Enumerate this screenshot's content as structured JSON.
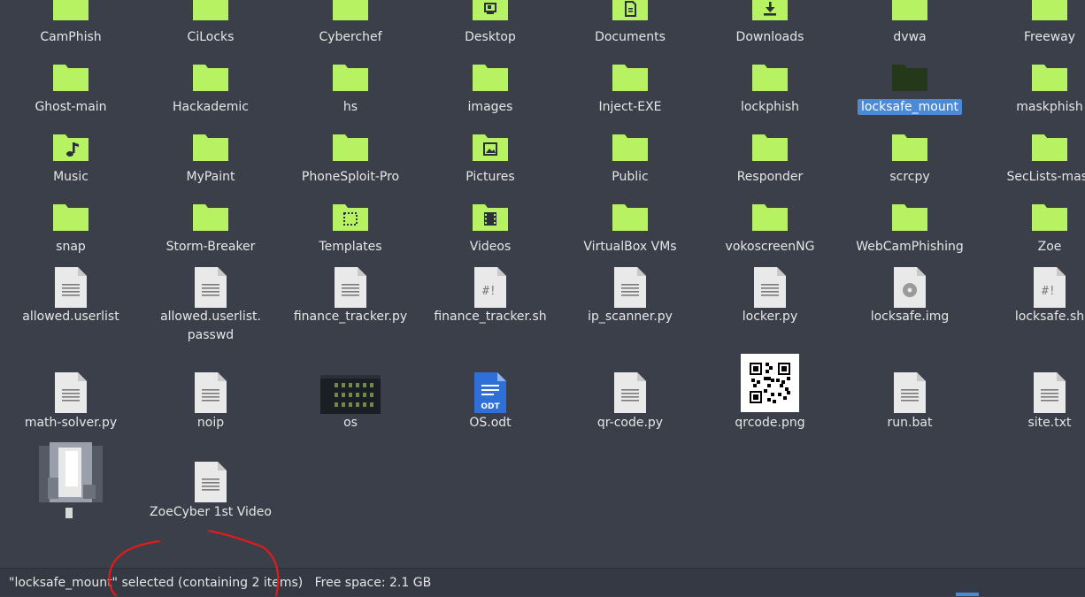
{
  "colors": {
    "background": "#3b3f4a",
    "folder": "#b6f261",
    "folder_dark": "#24381a",
    "selection": "#4c8ad6",
    "annotation": "#e01b1b"
  },
  "files": [
    {
      "label": "CamPhish",
      "icon": "folder"
    },
    {
      "label": "CiLocks",
      "icon": "folder"
    },
    {
      "label": "Cyberchef",
      "icon": "folder"
    },
    {
      "label": "Desktop",
      "icon": "folder-desktop"
    },
    {
      "label": "Documents",
      "icon": "folder-documents"
    },
    {
      "label": "Downloads",
      "icon": "folder-downloads"
    },
    {
      "label": "dvwa",
      "icon": "folder"
    },
    {
      "label": "Freeway",
      "icon": "folder"
    },
    {
      "label": "Ghost-main",
      "icon": "folder"
    },
    {
      "label": "Hackademic",
      "icon": "folder"
    },
    {
      "label": "hs",
      "icon": "folder"
    },
    {
      "label": "images",
      "icon": "folder"
    },
    {
      "label": "Inject-EXE",
      "icon": "folder"
    },
    {
      "label": "lockphish",
      "icon": "folder"
    },
    {
      "label": "locksafe_mount",
      "icon": "folder-dark",
      "selected": true
    },
    {
      "label": "maskphish",
      "icon": "folder"
    },
    {
      "label": "Music",
      "icon": "folder-music"
    },
    {
      "label": "MyPaint",
      "icon": "folder"
    },
    {
      "label": "PhoneSploit-Pro",
      "icon": "folder"
    },
    {
      "label": "Pictures",
      "icon": "folder-pictures"
    },
    {
      "label": "Public",
      "icon": "folder"
    },
    {
      "label": "Responder",
      "icon": "folder"
    },
    {
      "label": "scrcpy",
      "icon": "folder"
    },
    {
      "label": "SecLists-mast",
      "icon": "folder"
    },
    {
      "label": "snap",
      "icon": "folder"
    },
    {
      "label": "Storm-Breaker",
      "icon": "folder"
    },
    {
      "label": "Templates",
      "icon": "folder-templates"
    },
    {
      "label": "Videos",
      "icon": "folder-videos"
    },
    {
      "label": "VirtualBox VMs",
      "icon": "folder"
    },
    {
      "label": "vokoscreenNG",
      "icon": "folder"
    },
    {
      "label": "WebCamPhishing",
      "icon": "folder"
    },
    {
      "label": "Zoe",
      "icon": "folder"
    },
    {
      "label": "allowed.userlist",
      "icon": "text-file"
    },
    {
      "label": "allowed.userlist.\npasswd",
      "icon": "text-file"
    },
    {
      "label": "finance_tracker.py",
      "icon": "text-file"
    },
    {
      "label": "finance_tracker.sh",
      "icon": "script-file"
    },
    {
      "label": "ip_scanner.py",
      "icon": "text-file"
    },
    {
      "label": "locker.py",
      "icon": "text-file"
    },
    {
      "label": "locksafe.img",
      "icon": "disk-image"
    },
    {
      "label": "locksafe.sh",
      "icon": "script-file"
    },
    {
      "label": "math-solver.py",
      "icon": "text-file"
    },
    {
      "label": "noip",
      "icon": "text-file"
    },
    {
      "label": "os",
      "icon": "screenshot-thumbnail"
    },
    {
      "label": "OS.odt",
      "icon": "odt-document"
    },
    {
      "label": "qr-code.py",
      "icon": "text-file"
    },
    {
      "label": "qrcode.png",
      "icon": "qr-thumbnail"
    },
    {
      "label": "run.bat",
      "icon": "text-file"
    },
    {
      "label": "site.txt",
      "icon": "text-file"
    },
    {
      "label": "",
      "icon": "blurred-thumbnail"
    },
    {
      "label": "ZoeCyber 1st Video",
      "icon": "text-file"
    }
  ],
  "statusbar": {
    "selection_text": "\"locksafe_mount\" selected (containing 2 items)",
    "free_space_text": "Free space: 2.1 GB"
  }
}
